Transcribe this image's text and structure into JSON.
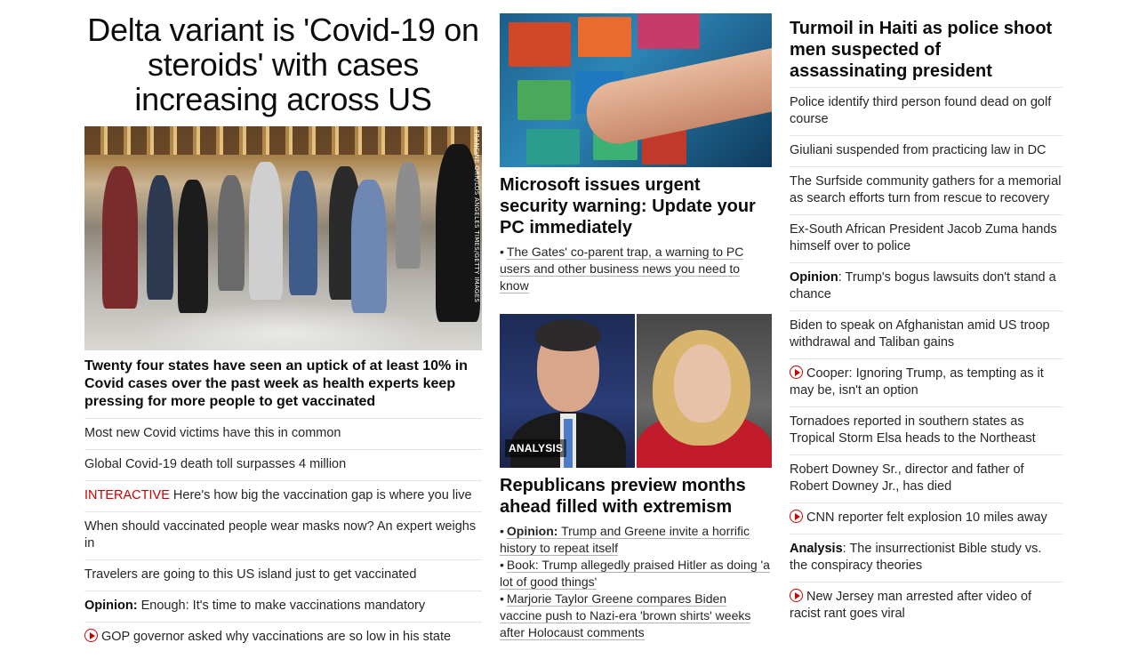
{
  "left": {
    "headline": "Delta variant is 'Covid-19 on steroids' with cases increasing across US",
    "photo_credit": "FRANCINE ORR/LOS ANGELES TIMES/GETTY IMAGES",
    "sub_headline": "Twenty four states have seen an uptick of at least 10% in Covid cases over the past week as health experts keep pressing for more people to get vaccinated",
    "items": [
      {
        "tag": "",
        "text": "Most new Covid victims have this in common"
      },
      {
        "tag": "",
        "text": "Global Covid-19 death toll surpasses 4 million"
      },
      {
        "tag": "INTERACTIVE",
        "text": "Here's how big the vaccination gap is where you live"
      },
      {
        "tag": "",
        "text": "When should vaccinated people wear masks now? An expert weighs in"
      },
      {
        "tag": "",
        "text": "Travelers are going to this US island just to get vaccinated"
      },
      {
        "tag": "Opinion:",
        "text": "Enough: It's time to make vaccinations mandatory"
      },
      {
        "tag": "",
        "text": "GOP governor asked why vaccinations are so low in his state"
      }
    ]
  },
  "middle": {
    "story1": {
      "headline": "Microsoft issues urgent security warning: Update your PC immediately",
      "bullets": [
        {
          "prefix": "",
          "text": "The Gates' co-parent trap, a warning to PC users and other business news you need to know"
        }
      ]
    },
    "story2": {
      "badge": "ANALYSIS",
      "headline": "Republicans preview months ahead filled with extremism",
      "bullets": [
        {
          "prefix": "Opinion:",
          "text": "Trump and Greene invite a horrific history to repeat itself"
        },
        {
          "prefix": "",
          "text": "Book: Trump allegedly praised Hitler as doing 'a lot of good things'"
        },
        {
          "prefix": "",
          "text": "Marjorie Taylor Greene compares Biden vaccine push to Nazi-era 'brown shirts' weeks after Holocaust comments"
        }
      ]
    }
  },
  "right": {
    "headline": "Turmoil in Haiti as police shoot men suspected of assassinating president",
    "items": [
      {
        "tag": "",
        "text": "Police identify third person found dead on golf course"
      },
      {
        "tag": "",
        "text": "Giuliani suspended from practicing law in DC"
      },
      {
        "tag": "",
        "text": "The Surfside community gathers for a memorial as search efforts turn from rescue to recovery"
      },
      {
        "tag": "",
        "text": "Ex-South African President Jacob Zuma hands himself over to police"
      },
      {
        "tag": "Opinion",
        "text": ": Trump's bogus lawsuits don't stand a chance"
      },
      {
        "tag": "",
        "text": "Biden to speak on Afghanistan amid US troop withdrawal and Taliban gains"
      },
      {
        "tag": "",
        "text": "Cooper: Ignoring Trump, as tempting as it may be, isn't an option"
      },
      {
        "tag": "",
        "text": "Tornadoes reported in southern states as Tropical Storm Elsa heads to the Northeast"
      },
      {
        "tag": "",
        "text": "Robert Downey Sr., director and father of Robert Downey Jr., has died"
      },
      {
        "tag": "",
        "text": "CNN reporter felt explosion 10 miles away"
      },
      {
        "tag": "Analysis",
        "text": ": The insurrectionist Bible study vs. the conspiracy theories"
      },
      {
        "tag": "",
        "text": "New Jersey man arrested after video of racist rant goes viral"
      }
    ]
  },
  "icons": {
    "video": "play-circle-icon"
  },
  "colors": {
    "accent": "#cc0000",
    "text": "#262626",
    "divider": "#e6e6e6"
  }
}
